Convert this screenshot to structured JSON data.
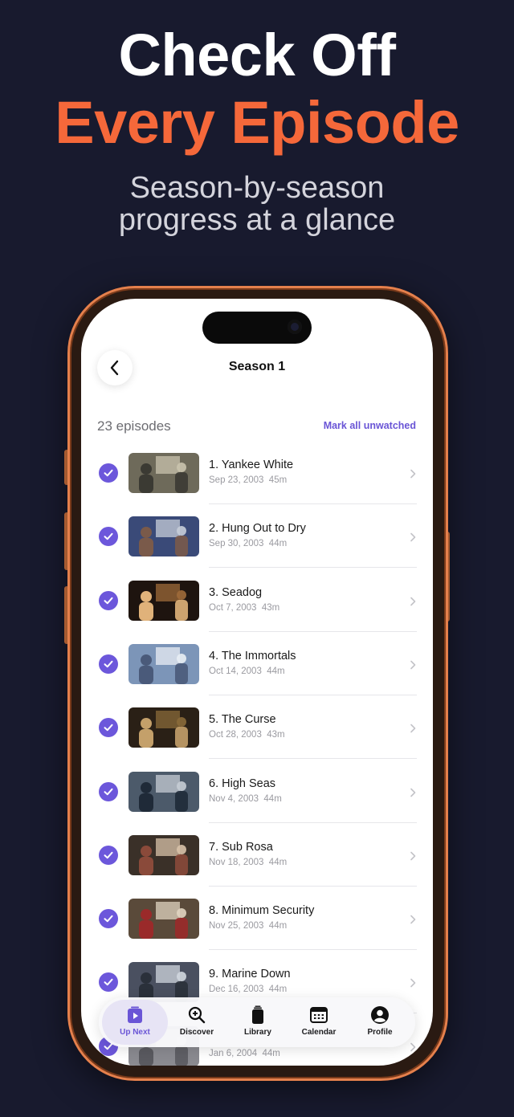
{
  "headline": {
    "line1": "Check Off",
    "line2": "Every Episode"
  },
  "subtitle": {
    "line1": "Season-by-season",
    "line2": "progress at a glance"
  },
  "screen": {
    "title": "Season 1",
    "episode_count": "23 episodes",
    "mark_all": "Mark all unwatched",
    "episodes": [
      {
        "title": "1. Yankee White",
        "meta": "Sep 23, 2003  45m",
        "watched": true
      },
      {
        "title": "2. Hung Out to Dry",
        "meta": "Sep 30, 2003  44m",
        "watched": true
      },
      {
        "title": "3. Seadog",
        "meta": "Oct 7, 2003  43m",
        "watched": true
      },
      {
        "title": "4. The Immortals",
        "meta": "Oct 14, 2003  44m",
        "watched": true
      },
      {
        "title": "5. The Curse",
        "meta": "Oct 28, 2003  43m",
        "watched": true
      },
      {
        "title": "6. High Seas",
        "meta": "Nov 4, 2003  44m",
        "watched": true
      },
      {
        "title": "7. Sub Rosa",
        "meta": "Nov 18, 2003  44m",
        "watched": true
      },
      {
        "title": "8. Minimum Security",
        "meta": "Nov 25, 2003  44m",
        "watched": true
      },
      {
        "title": "9. Marine Down",
        "meta": "Dec 16, 2003  44m",
        "watched": true
      },
      {
        "title": "",
        "meta": "Jan 6, 2004  44m",
        "watched": true
      }
    ],
    "tabs": [
      {
        "label": "Up Next",
        "icon": "play-icon",
        "active": true
      },
      {
        "label": "Discover",
        "icon": "search-plus-icon",
        "active": false
      },
      {
        "label": "Library",
        "icon": "library-icon",
        "active": false
      },
      {
        "label": "Calendar",
        "icon": "calendar-icon",
        "active": false
      },
      {
        "label": "Profile",
        "icon": "profile-icon",
        "active": false
      }
    ]
  },
  "colors": {
    "accent": "#6a55d6",
    "brand_orange": "#f5683a",
    "background": "#181a2e"
  }
}
